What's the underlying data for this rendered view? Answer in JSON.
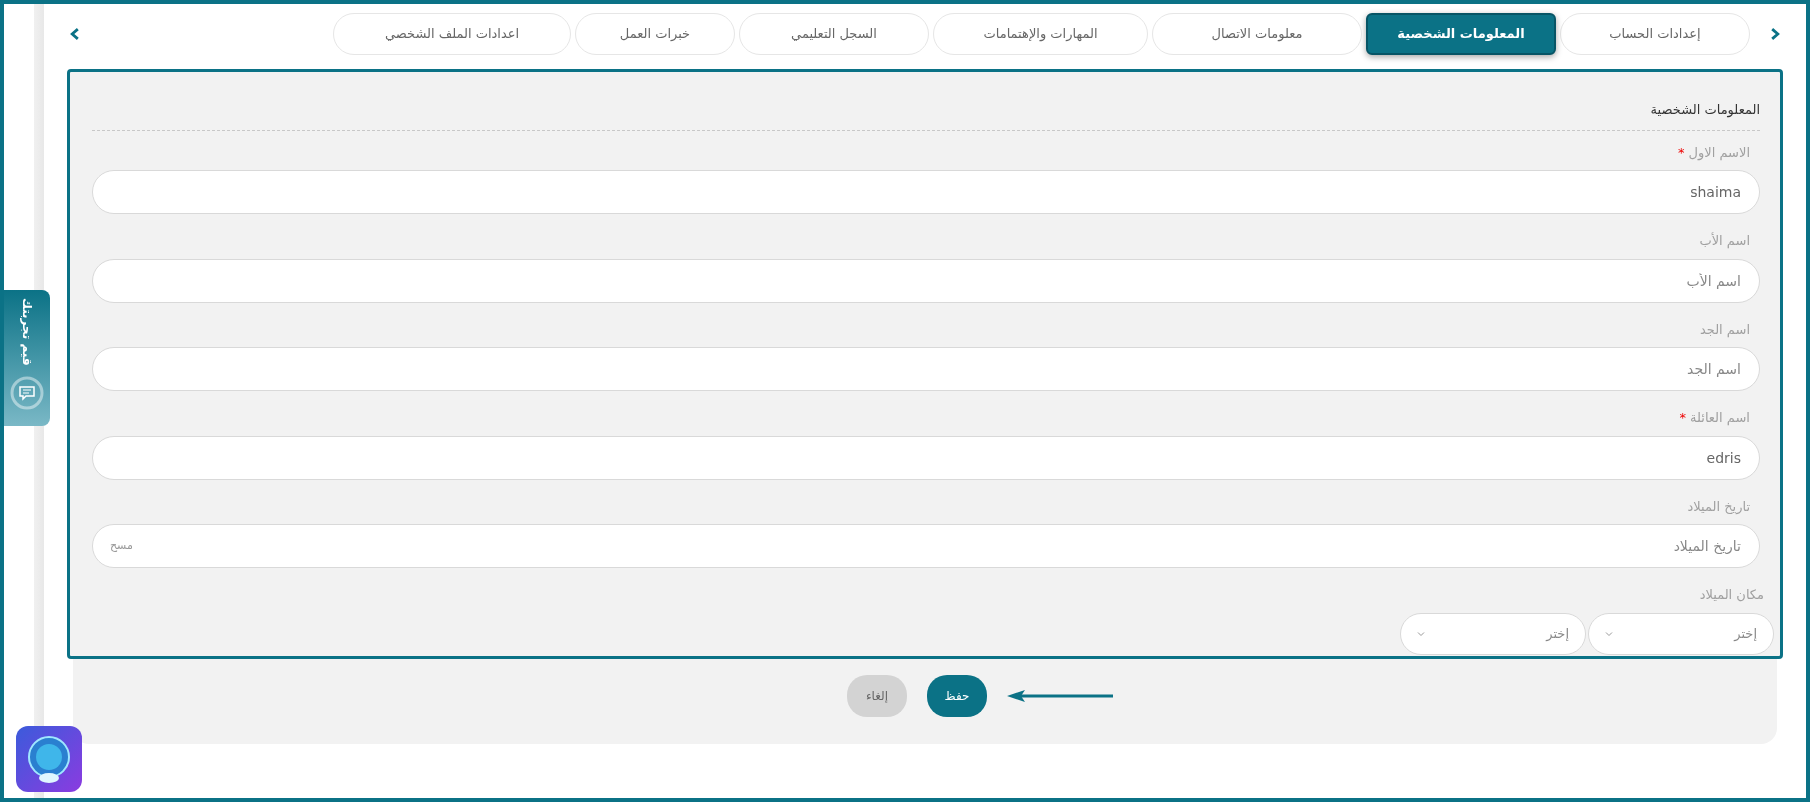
{
  "tabs": [
    {
      "label": "إعدادات الحساب",
      "selected": false
    },
    {
      "label": "المعلومات الشخصية",
      "selected": true
    },
    {
      "label": "معلومات الاتصال",
      "selected": false
    },
    {
      "label": "المهارات والإهتمامات",
      "selected": false
    },
    {
      "label": "السجل التعليمي",
      "selected": false
    },
    {
      "label": "خبرات العمل",
      "selected": false
    },
    {
      "label": "اعدادات الملف الشخصي",
      "selected": false
    }
  ],
  "section_title": "المعلومات الشخصية",
  "fields": [
    {
      "kind": "text",
      "label": "الاسم الاول",
      "mark": "*",
      "value": "shaima"
    },
    {
      "kind": "text",
      "label": "اسم الأب",
      "placeholder": "اسم الأب"
    },
    {
      "kind": "text",
      "label": "اسم الجد",
      "placeholder": "اسم الجد"
    },
    {
      "kind": "text",
      "label": "اسم العائلة",
      "mark": "*",
      "value": "edris"
    },
    {
      "kind": "date",
      "label": "تاريخ الميلاد",
      "placeholder": "تاريخ الميلاد",
      "clear_label": "مسح"
    },
    {
      "kind": "select_pair",
      "label": "مكان الميلاد",
      "selects": [
        {
          "value": "إختر"
        },
        {
          "value": "إختر"
        }
      ]
    }
  ],
  "buttons": [
    {
      "kind": "primary",
      "label": "حفظ"
    },
    {
      "kind": "secondary",
      "label": "إلغاء"
    }
  ],
  "feedback_tab": {
    "label": "قيم تجربتك"
  }
}
